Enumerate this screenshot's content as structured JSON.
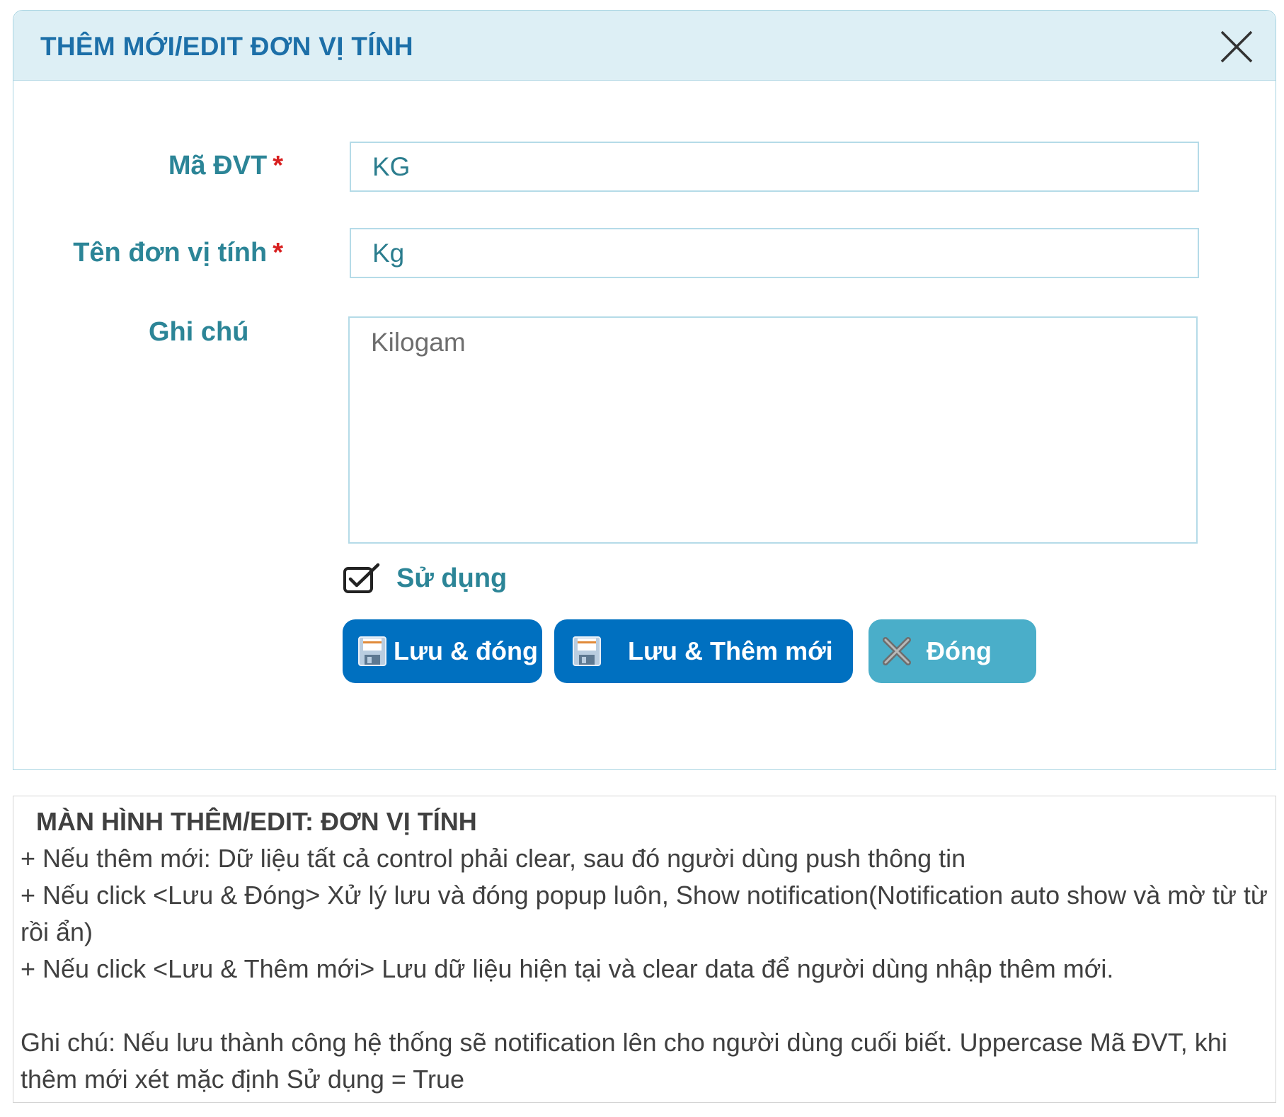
{
  "dialog": {
    "title": "THÊM MỚI/EDIT ĐƠN VỊ TÍNH",
    "close_icon": "close-icon"
  },
  "form": {
    "ma_dvt": {
      "label": "Mã ĐVT",
      "required_mark": "*",
      "value": "KG"
    },
    "ten_dvt": {
      "label": "Tên đơn vị tính",
      "required_mark": "*",
      "value": "Kg"
    },
    "ghi_chu": {
      "label": "Ghi chú",
      "value": "Kilogam"
    },
    "su_dung": {
      "label": "Sử dụng",
      "checked": true
    }
  },
  "buttons": {
    "save_close": {
      "label": "Lưu & đóng",
      "icon": "floppy-disk-icon"
    },
    "save_new": {
      "label": "Lưu & Thêm mới",
      "icon": "floppy-disk-icon"
    },
    "close": {
      "label": "Đóng",
      "icon": "x-icon"
    }
  },
  "notes": {
    "title": "MÀN HÌNH THÊM/EDIT: ĐƠN VỊ TÍNH",
    "lines": [
      "+ Nếu thêm mới: Dữ liệu tất cả control phải clear, sau đó người dùng push thông tin",
      "+ Nếu click <Lưu & Đóng> Xử lý lưu và đóng popup luôn, Show notification(Notification auto show và mờ từ từ rồi ẩn)",
      "+ Nếu click <Lưu & Thêm mới> Lưu dữ liệu hiện tại và clear data để người dùng nhập thêm mới.",
      "Ghi chú: Nếu lưu thành công hệ thống sẽ notification lên cho người dùng cuối biết. Uppercase Mã ĐVT, khi thêm mới xét mặc định Sử dụng = True"
    ]
  },
  "colors": {
    "header_bg": "#ddeff5",
    "title": "#1c6fa8",
    "label": "#2c8597",
    "required": "#d81f1f",
    "primary_button": "#0070c0",
    "close_button": "#4aaec9"
  }
}
